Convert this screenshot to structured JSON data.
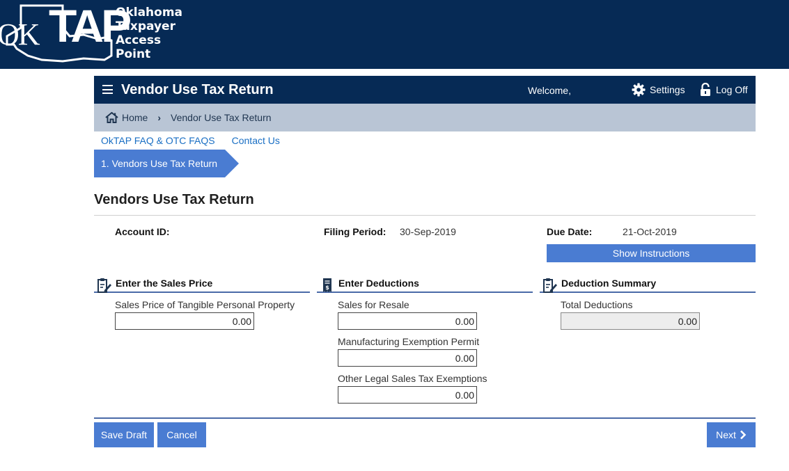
{
  "brand": {
    "logo_ok": "OK",
    "logo_tap": "TAP",
    "words": [
      "Oklahoma",
      "Taxpayer",
      "Access",
      "Point"
    ]
  },
  "header": {
    "title": "Vendor Use Tax Return",
    "welcome": "Welcome,",
    "settings_label": "Settings",
    "logoff_label": "Log Off",
    "icons": [
      "menu-icon",
      "gear-icon",
      "lock-icon"
    ]
  },
  "breadcrumb": {
    "home": "Home",
    "current": "Vendor Use Tax Return"
  },
  "links": {
    "faq": "OkTAP FAQ & OTC FAQS",
    "contact": "Contact Us"
  },
  "steps": [
    "1. Vendors Use Tax Return"
  ],
  "page": {
    "heading": "Vendors Use Tax Return",
    "account_label": "Account ID:",
    "account_value": "",
    "period_label": "Filing Period:",
    "period_value": "30-Sep-2019",
    "due_label": "Due Date:",
    "due_value": "21-Oct-2019",
    "instructions_button": "Show Instructions"
  },
  "sections": {
    "sales": {
      "title": "Enter the Sales Price",
      "fields": [
        {
          "label": "Sales Price of Tangible Personal Property",
          "value": "0.00"
        }
      ]
    },
    "deductions": {
      "title": "Enter Deductions",
      "fields": [
        {
          "label": "Sales for Resale",
          "value": "0.00"
        },
        {
          "label": "Manufacturing Exemption Permit",
          "value": "0.00"
        },
        {
          "label": "Other Legal Sales Tax Exemptions",
          "value": "0.00"
        }
      ]
    },
    "summary": {
      "title": "Deduction Summary",
      "fields": [
        {
          "label": "Total Deductions",
          "value": "0.00"
        }
      ]
    }
  },
  "actions": {
    "save_draft": "Save Draft",
    "cancel": "Cancel",
    "next": "Next"
  },
  "colors": {
    "navy": "#062a55",
    "accent": "#4a7cd2",
    "breadcrumb_bg": "#b9c5d5",
    "link": "#1a6fc4"
  }
}
